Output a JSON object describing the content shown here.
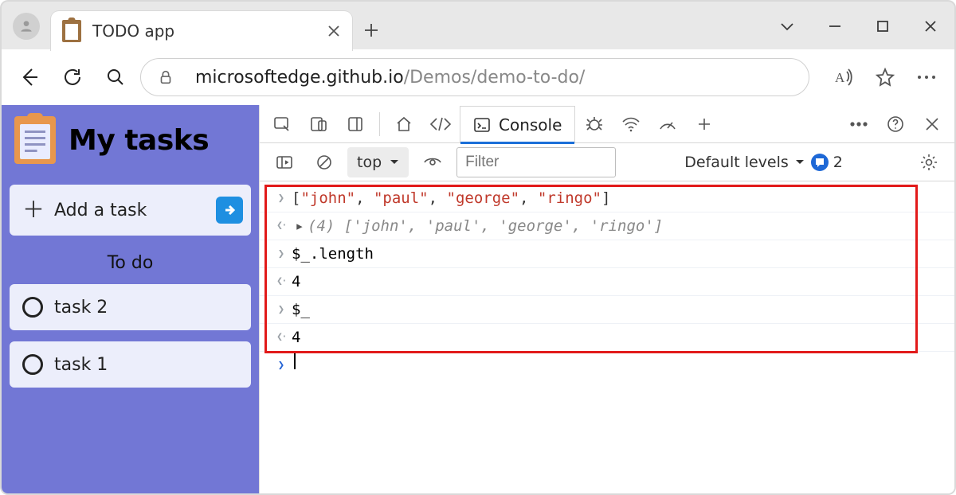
{
  "browser": {
    "tab_title": "TODO app",
    "url_host": "microsoftedge.github.io",
    "url_path": "/Demos/demo-to-do/"
  },
  "app_panel": {
    "title": "My tasks",
    "add_placeholder": "Add a task",
    "section_label": "To do",
    "tasks": [
      "task 2",
      "task 1"
    ]
  },
  "devtools": {
    "tab_label": "Console",
    "context": "top",
    "filter_placeholder": "Filter",
    "levels_label": "Default levels",
    "issues_count": "2",
    "console": {
      "row0_input": "[\"john\", \"paul\", \"george\", \"ringo\"]",
      "row1_output_len": "(4)",
      "row1_output_arr": "['john', 'paul', 'george', 'ringo']",
      "row2_input": "$_.length",
      "row3_output": "4",
      "row4_input": "$_",
      "row5_output": "4"
    }
  }
}
